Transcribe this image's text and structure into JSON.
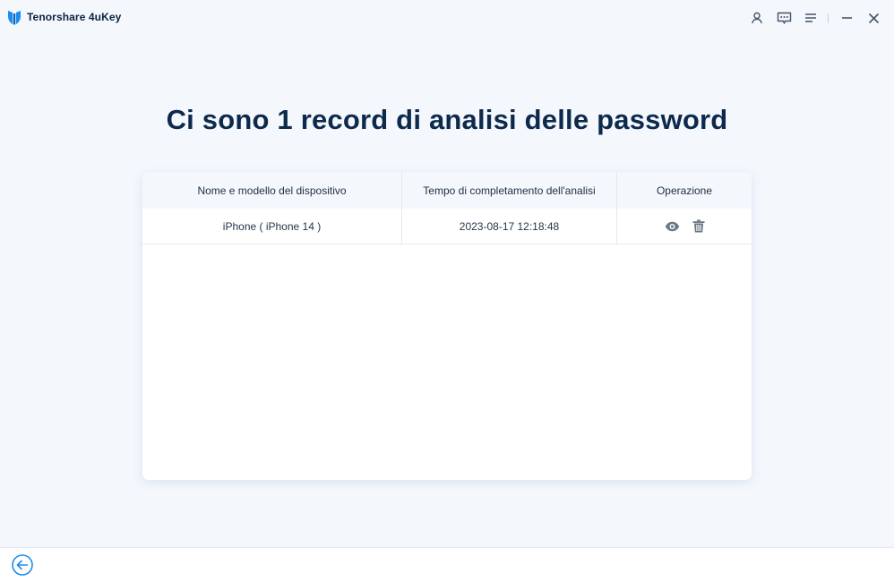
{
  "app": {
    "title": "Tenorshare 4uKey"
  },
  "titlebar": {
    "icons": [
      "user-icon",
      "feedback-icon",
      "menu-icon",
      "minimize-icon",
      "close-icon"
    ]
  },
  "main": {
    "heading": "Ci sono 1 record di analisi delle password"
  },
  "table": {
    "headers": [
      "Nome e modello del dispositivo",
      "Tempo di completamento dell'analisi",
      "Operazione"
    ],
    "rows": [
      {
        "device": "iPhone ( iPhone 14 )",
        "time": "2023-08-17 12:18:48",
        "actions": [
          "eye-icon",
          "trash-icon"
        ]
      }
    ]
  },
  "footer": {
    "back_icon": "back-arrow-icon"
  },
  "colors": {
    "accent": "#1a8cf0",
    "heading": "#0d2a4c",
    "background": "#f4f8fd",
    "icon_gray": "#6b7785"
  }
}
